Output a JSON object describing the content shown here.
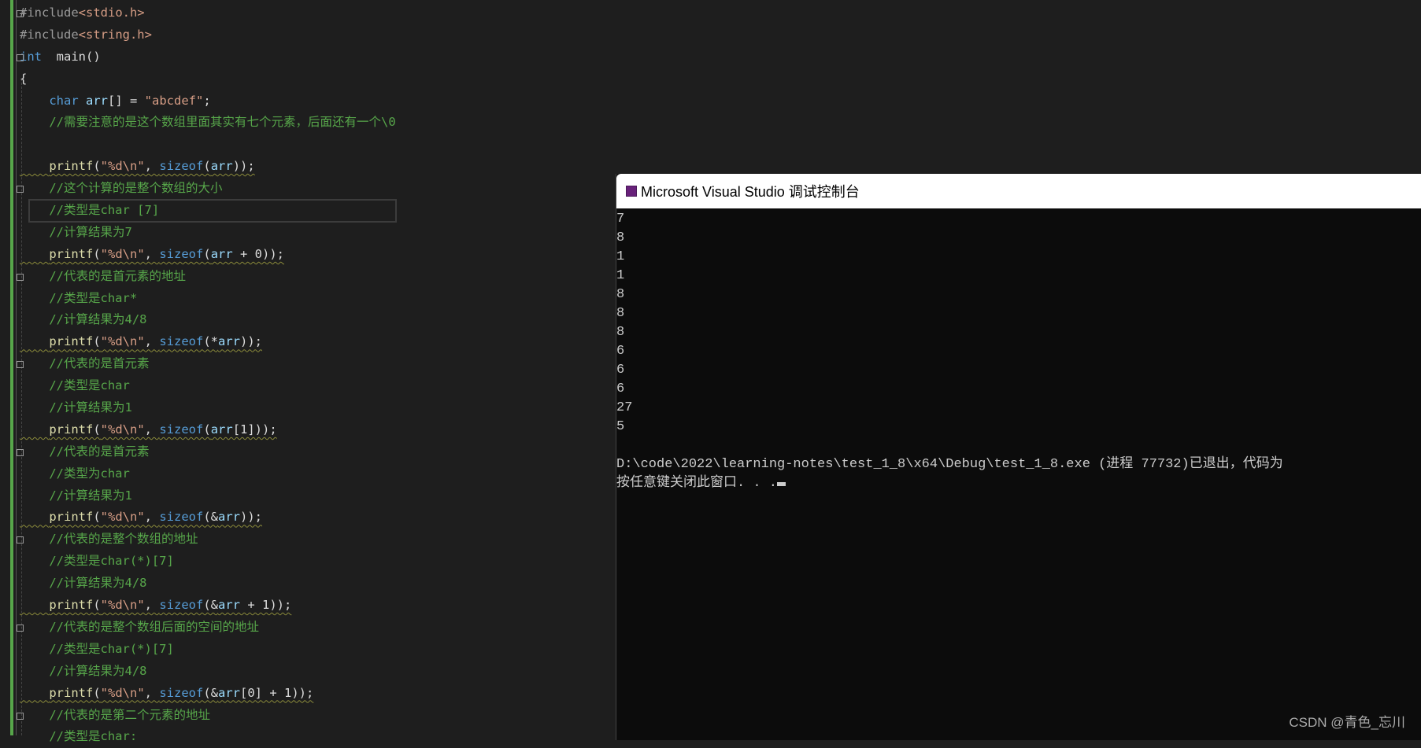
{
  "editor": {
    "lines": [
      {
        "parts": [
          [
            "pp",
            "#include"
          ],
          [
            "str",
            "<stdio.h>"
          ]
        ]
      },
      {
        "parts": [
          [
            "pp",
            "#include"
          ],
          [
            "str",
            "<string.h>"
          ]
        ]
      },
      {
        "parts": [
          [
            "kw",
            "int"
          ],
          [
            "",
            "  main()"
          ]
        ]
      },
      {
        "parts": [
          [
            "",
            "{"
          ]
        ]
      },
      {
        "parts": [
          [
            "",
            "    "
          ],
          [
            "kw",
            "char"
          ],
          [
            "var",
            " arr"
          ],
          [
            "",
            "[] = "
          ],
          [
            "str",
            "\"abcdef\""
          ],
          [
            "",
            ";"
          ]
        ]
      },
      {
        "parts": [
          [
            "",
            "    "
          ],
          [
            "cm",
            "//需要注意的是这个数组里面其实有七个元素，后面还有一个\\0"
          ]
        ]
      },
      {
        "parts": [
          [
            "",
            ""
          ]
        ]
      },
      {
        "parts": [
          [
            "",
            "    "
          ],
          [
            "fn",
            "printf"
          ],
          [
            "",
            "("
          ],
          [
            "str",
            "\"%d\\n\""
          ],
          [
            "",
            ", "
          ],
          [
            "kw",
            "sizeof"
          ],
          [
            "",
            "("
          ],
          [
            "var",
            "arr"
          ],
          [
            "",
            "));"
          ]
        ]
      },
      {
        "parts": [
          [
            "",
            "    "
          ],
          [
            "cm",
            "//这个计算的是整个数组的大小"
          ]
        ]
      },
      {
        "parts": [
          [
            "",
            "    "
          ],
          [
            "cm",
            "//类型是char [7]"
          ]
        ]
      },
      {
        "parts": [
          [
            "",
            "    "
          ],
          [
            "cm",
            "//计算结果为7"
          ]
        ]
      },
      {
        "parts": [
          [
            "",
            "    "
          ],
          [
            "fn",
            "printf"
          ],
          [
            "",
            "("
          ],
          [
            "str",
            "\"%d\\n\""
          ],
          [
            "",
            ", "
          ],
          [
            "kw",
            "sizeof"
          ],
          [
            "",
            "("
          ],
          [
            "var",
            "arr"
          ],
          [
            "",
            " + 0));"
          ]
        ]
      },
      {
        "parts": [
          [
            "",
            "    "
          ],
          [
            "cm",
            "//代表的是首元素的地址"
          ]
        ]
      },
      {
        "parts": [
          [
            "",
            "    "
          ],
          [
            "cm",
            "//类型是char*"
          ]
        ]
      },
      {
        "parts": [
          [
            "",
            "    "
          ],
          [
            "cm",
            "//计算结果为4/8"
          ]
        ]
      },
      {
        "parts": [
          [
            "",
            "    "
          ],
          [
            "fn",
            "printf"
          ],
          [
            "",
            "("
          ],
          [
            "str",
            "\"%d\\n\""
          ],
          [
            "",
            ", "
          ],
          [
            "kw",
            "sizeof"
          ],
          [
            "",
            "(*"
          ],
          [
            "var",
            "arr"
          ],
          [
            "",
            "));"
          ]
        ]
      },
      {
        "parts": [
          [
            "",
            "    "
          ],
          [
            "cm",
            "//代表的是首元素"
          ]
        ]
      },
      {
        "parts": [
          [
            "",
            "    "
          ],
          [
            "cm",
            "//类型是char"
          ]
        ]
      },
      {
        "parts": [
          [
            "",
            "    "
          ],
          [
            "cm",
            "//计算结果为1"
          ]
        ]
      },
      {
        "parts": [
          [
            "",
            "    "
          ],
          [
            "fn",
            "printf"
          ],
          [
            "",
            "("
          ],
          [
            "str",
            "\"%d\\n\""
          ],
          [
            "",
            ", "
          ],
          [
            "kw",
            "sizeof"
          ],
          [
            "",
            "("
          ],
          [
            "var",
            "arr"
          ],
          [
            "",
            "[1]));"
          ]
        ]
      },
      {
        "parts": [
          [
            "",
            "    "
          ],
          [
            "cm",
            "//代表的是首元素"
          ]
        ]
      },
      {
        "parts": [
          [
            "",
            "    "
          ],
          [
            "cm",
            "//类型为char"
          ]
        ]
      },
      {
        "parts": [
          [
            "",
            "    "
          ],
          [
            "cm",
            "//计算结果为1"
          ]
        ]
      },
      {
        "parts": [
          [
            "",
            "    "
          ],
          [
            "fn",
            "printf"
          ],
          [
            "",
            "("
          ],
          [
            "str",
            "\"%d\\n\""
          ],
          [
            "",
            ", "
          ],
          [
            "kw",
            "sizeof"
          ],
          [
            "",
            "(&"
          ],
          [
            "var",
            "arr"
          ],
          [
            "",
            "));"
          ]
        ]
      },
      {
        "parts": [
          [
            "",
            "    "
          ],
          [
            "cm",
            "//代表的是整个数组的地址"
          ]
        ]
      },
      {
        "parts": [
          [
            "",
            "    "
          ],
          [
            "cm",
            "//类型是char(*)[7]"
          ]
        ]
      },
      {
        "parts": [
          [
            "",
            "    "
          ],
          [
            "cm",
            "//计算结果为4/8"
          ]
        ]
      },
      {
        "parts": [
          [
            "",
            "    "
          ],
          [
            "fn",
            "printf"
          ],
          [
            "",
            "("
          ],
          [
            "str",
            "\"%d\\n\""
          ],
          [
            "",
            ", "
          ],
          [
            "kw",
            "sizeof"
          ],
          [
            "",
            "(&"
          ],
          [
            "var",
            "arr"
          ],
          [
            "",
            " + 1));"
          ]
        ]
      },
      {
        "parts": [
          [
            "",
            "    "
          ],
          [
            "cm",
            "//代表的是整个数组后面的空间的地址"
          ]
        ]
      },
      {
        "parts": [
          [
            "",
            "    "
          ],
          [
            "cm",
            "//类型是char(*)[7]"
          ]
        ]
      },
      {
        "parts": [
          [
            "",
            "    "
          ],
          [
            "cm",
            "//计算结果为4/8"
          ]
        ]
      },
      {
        "parts": [
          [
            "",
            "    "
          ],
          [
            "fn",
            "printf"
          ],
          [
            "",
            "("
          ],
          [
            "str",
            "\"%d\\n\""
          ],
          [
            "",
            ", "
          ],
          [
            "kw",
            "sizeof"
          ],
          [
            "",
            "(&"
          ],
          [
            "var",
            "arr"
          ],
          [
            "",
            "[0] + 1));"
          ]
        ]
      },
      {
        "parts": [
          [
            "",
            "    "
          ],
          [
            "cm",
            "//代表的是第二个元素的地址"
          ]
        ]
      },
      {
        "parts": [
          [
            "",
            "    "
          ],
          [
            "cm",
            "//类型是char:"
          ]
        ]
      }
    ]
  },
  "console": {
    "title": "Microsoft Visual Studio 调试控制台",
    "output": [
      "7",
      "8",
      "1",
      "1",
      "8",
      "8",
      "8",
      "6",
      "6",
      "6",
      "27",
      "5",
      ""
    ],
    "exit_message": "D:\\code\\2022\\learning-notes\\test_1_8\\x64\\Debug\\test_1_8.exe (进程 77732)已退出，代码为",
    "prompt": "按任意键关闭此窗口. . ."
  },
  "watermark": "CSDN @青色_忘川"
}
